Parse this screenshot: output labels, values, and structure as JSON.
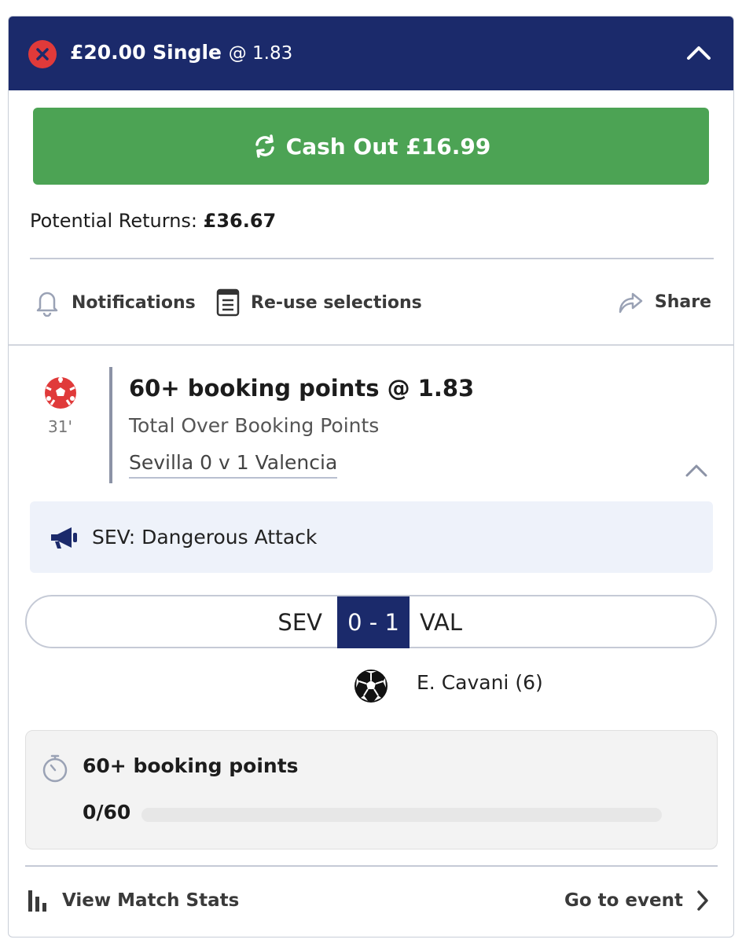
{
  "header": {
    "stake_label": "£20.00 Single",
    "odds_label": "@ 1.83",
    "status_icon": "close-circle-icon",
    "collapse_icon": "chevron-up-icon",
    "color": "#1b2a6b"
  },
  "cash_out": {
    "label": "Cash Out £16.99",
    "icon": "refresh-icon",
    "color": "#4ca354"
  },
  "returns": {
    "label": "Potential Returns:",
    "value": "£36.67"
  },
  "actions": {
    "notifications": "Notifications",
    "reuse": "Re-use selections",
    "share": "Share"
  },
  "selection": {
    "minute": "31'",
    "title": "60+ booking points @ 1.83",
    "market": "Total Over Booking Points",
    "event": "Sevilla 0 v 1 Valencia"
  },
  "alert": {
    "text": "SEV: Dangerous Attack",
    "icon": "megaphone-icon"
  },
  "scoreboard": {
    "home": "SEV",
    "score": "0 - 1",
    "away": "VAL"
  },
  "goal": {
    "scorer": "E. Cavani (6)"
  },
  "tracker": {
    "title": "60+ booking points",
    "progress_text": "0/60",
    "progress": 0
  },
  "footer": {
    "stats": "View Match Stats",
    "go_to_event": "Go to event"
  }
}
